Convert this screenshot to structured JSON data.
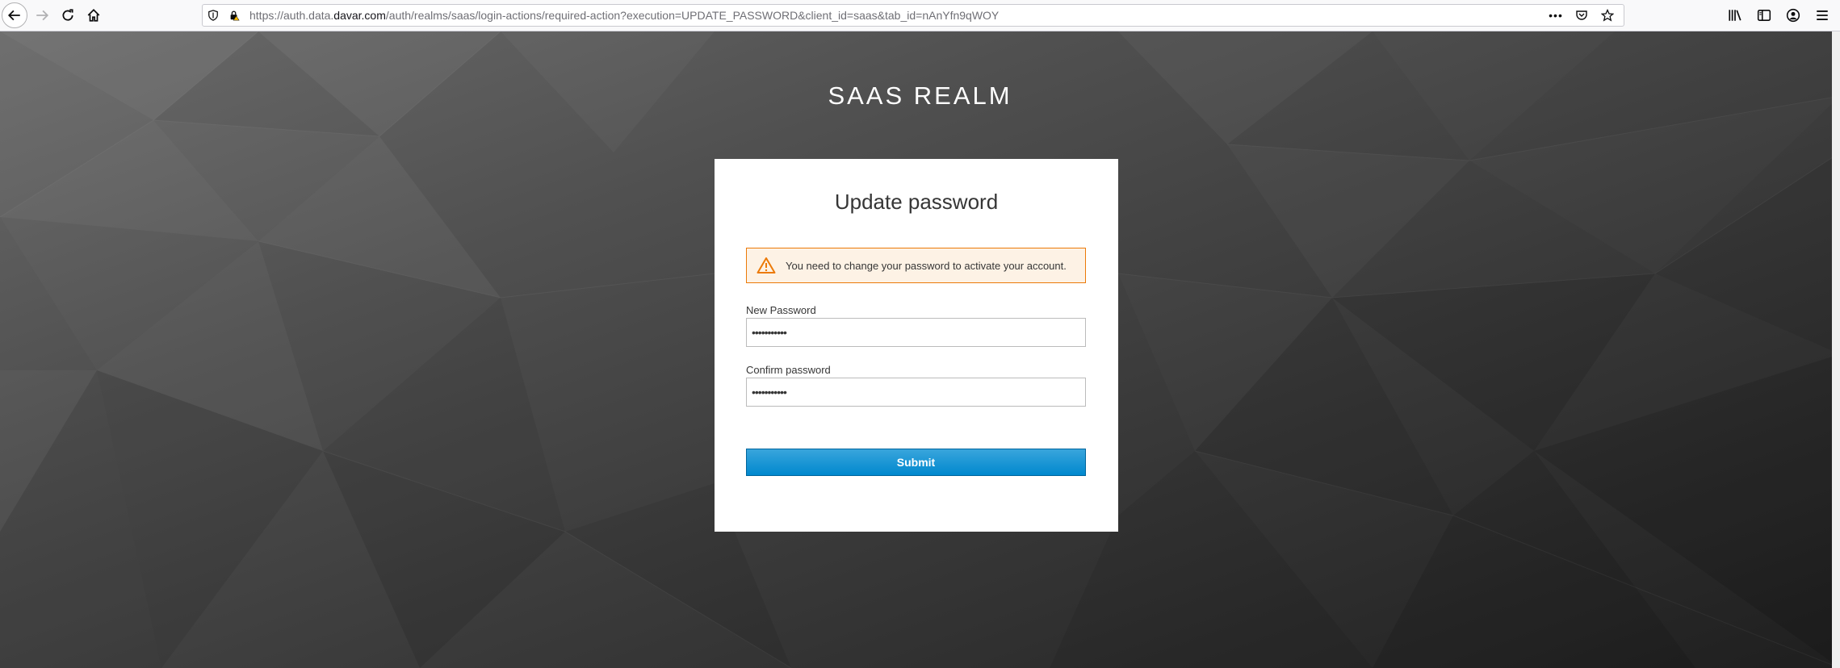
{
  "browser": {
    "url_prefix": "https://auth.data.",
    "url_domain": "davar.com",
    "url_path": "/auth/realms/saas/login-actions/required-action?execution=UPDATE_PASSWORD&client_id=saas&tab_id=nAnYfn9qWOY",
    "overflow_menu": "•••"
  },
  "page": {
    "realm_title": "SAAS REALM",
    "card_title": "Update password",
    "alert": {
      "icon": "warning-triangle-icon",
      "text": "You need to change your password to activate your account.",
      "border_color": "#ec7a08",
      "background": "#fdf2e5"
    },
    "new_password": {
      "label": "New Password",
      "value": "•••••••••••"
    },
    "confirm_password": {
      "label": "Confirm password",
      "value": "•••••••••••"
    },
    "submit_label": "Submit",
    "accent_color": "#0088ce"
  }
}
